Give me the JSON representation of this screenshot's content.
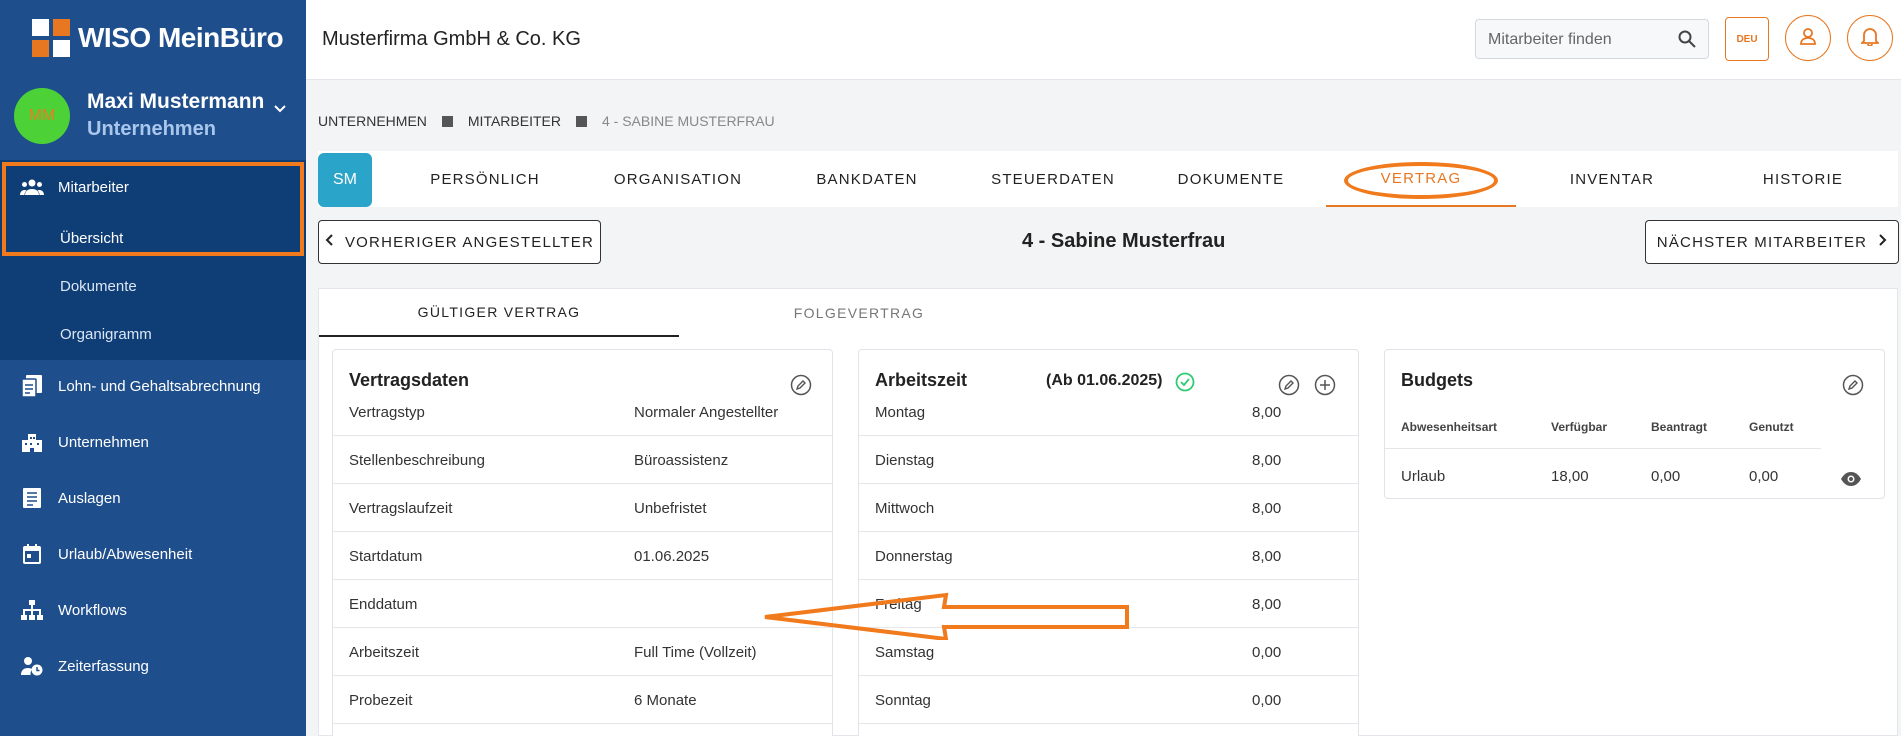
{
  "brand": {
    "logo_text": "WISO MeinBüro"
  },
  "user": {
    "initials": "MM",
    "name": "Maxi Mustermann",
    "role": "Unternehmen"
  },
  "sidebar": {
    "items": [
      {
        "label": "Mitarbeiter",
        "icon": "people-icon"
      },
      {
        "label": "Lohn- und Gehaltsabrechnung",
        "icon": "payroll-icon"
      },
      {
        "label": "Unternehmen",
        "icon": "building-icon"
      },
      {
        "label": "Auslagen",
        "icon": "receipt-icon"
      },
      {
        "label": "Urlaub/Abwesenheit",
        "icon": "calendar-icon"
      },
      {
        "label": "Workflows",
        "icon": "workflow-icon"
      },
      {
        "label": "Zeiterfassung",
        "icon": "time-tracking-icon"
      }
    ],
    "subitems": [
      {
        "label": "Übersicht"
      },
      {
        "label": "Dokumente"
      },
      {
        "label": "Organigramm"
      }
    ]
  },
  "header": {
    "company": "Musterfirma GmbH & Co. KG",
    "search_placeholder": "Mitarbeiter finden",
    "lang": "DEU"
  },
  "breadcrumb": [
    "UNTERNEHMEN",
    "MITARBEITER",
    "4 - SABINE MUSTERFRAU"
  ],
  "tabs": {
    "avatar": "SM",
    "items": [
      "PERSÖNLICH",
      "ORGANISATION",
      "BANKDATEN",
      "STEUERDATEN",
      "DOKUMENTE",
      "VERTRAG",
      "INVENTAR",
      "HISTORIE"
    ],
    "active": "VERTRAG"
  },
  "employee": {
    "prev_label": "VORHERIGER ANGESTELLTER",
    "title": "4 - Sabine Musterfrau",
    "next_label": "NÄCHSTER MITARBEITER"
  },
  "contract_tabs": [
    "GÜLTIGER VERTRAG",
    "FOLGEVERTRAG"
  ],
  "vertragsdaten": {
    "title": "Vertragsdaten",
    "rows": [
      {
        "k": "Vertragstyp",
        "v": "Normaler Angestellter"
      },
      {
        "k": "Stellenbeschreibung",
        "v": "Büroassistenz"
      },
      {
        "k": "Vertragslaufzeit",
        "v": "Unbefristet"
      },
      {
        "k": "Startdatum",
        "v": "01.06.2025"
      },
      {
        "k": "Enddatum",
        "v": ""
      },
      {
        "k": "Arbeitszeit",
        "v": "Full Time (Vollzeit)"
      },
      {
        "k": "Probezeit",
        "v": "6 Monate"
      }
    ]
  },
  "arbeitszeit": {
    "title": "Arbeitszeit",
    "since": "(Ab 01.06.2025)",
    "rows": [
      {
        "k": "Montag",
        "v": "8,00"
      },
      {
        "k": "Dienstag",
        "v": "8,00"
      },
      {
        "k": "Mittwoch",
        "v": "8,00"
      },
      {
        "k": "Donnerstag",
        "v": "8,00"
      },
      {
        "k": "Freitag",
        "v": "8,00"
      },
      {
        "k": "Samstag",
        "v": "0,00"
      },
      {
        "k": "Sonntag",
        "v": "0,00"
      }
    ]
  },
  "budgets": {
    "title": "Budgets",
    "headers": [
      "Abwesenheitsart",
      "Verfügbar",
      "Beantragt",
      "Genutzt"
    ],
    "rows": [
      {
        "art": "Urlaub",
        "verfuegbar": "18,00",
        "beantragt": "0,00",
        "genutzt": "0,00"
      }
    ]
  },
  "colors": {
    "sidebar": "#1f4e8c",
    "accent": "#e87722",
    "annotation": "#f07a1c"
  }
}
